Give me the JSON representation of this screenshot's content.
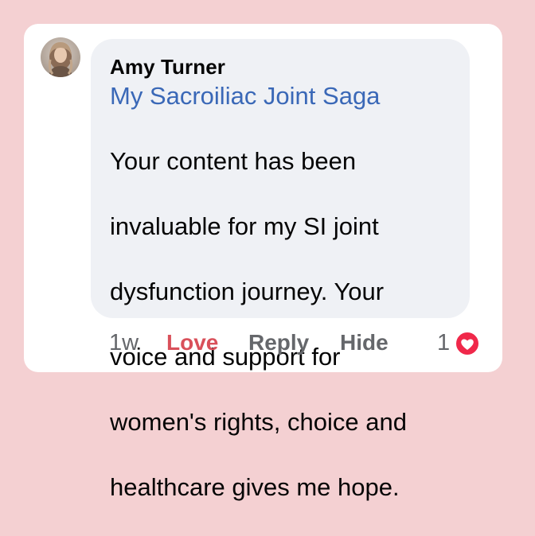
{
  "comment": {
    "author": "Amy Turner",
    "group": "My Sacroiliac Joint Saga",
    "body_lines": [
      "Your content has been",
      "invaluable for my SI joint",
      "dysfunction journey. Your",
      "voice and support for",
      "women's rights, choice and",
      "healthcare gives me hope."
    ],
    "avatar_icon": "profile-photo",
    "colors": {
      "page_background": "#f4d0d2",
      "bubble_background": "#eff1f5",
      "link": "#3a68b7",
      "love_reaction": "#d9505a",
      "muted": "#65676b"
    }
  },
  "actions": {
    "timestamp": "1w",
    "love_label": "Love",
    "reply_label": "Reply",
    "hide_label": "Hide",
    "reaction_count": "1",
    "reaction_icon": "heart-icon"
  }
}
